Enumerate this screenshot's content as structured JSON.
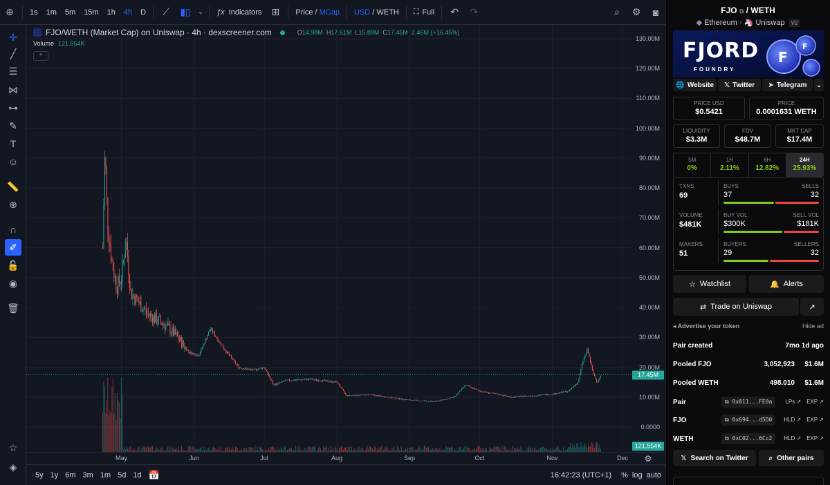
{
  "topbar": {
    "intervals": [
      "1s",
      "1m",
      "5m",
      "15m",
      "1h",
      "4h",
      "D"
    ],
    "active_interval": "4h",
    "indicators_label": "Indicators",
    "price_label": "Price",
    "mcap_label": "MCap",
    "usd_label": "USD",
    "weth_label": "WETH",
    "full_label": "Full"
  },
  "chart": {
    "legend_title": "FJO/WETH (Market Cap) on Uniswap · 4h · dexscreener.com",
    "ohlc": {
      "o_label": "O",
      "o": "14.98M",
      "h_label": "H",
      "h": "17.61M",
      "l_label": "L",
      "l": "15.88M",
      "c_label": "C",
      "c": "17.45M",
      "change": "2.46M (+16.45%)"
    },
    "volume_label": "Volume",
    "volume_value": "121.554K",
    "current_price_badge": "17.45M",
    "current_volume_badge": "121.554K"
  },
  "chart_data": {
    "type": "line",
    "ylabel": "Market Cap",
    "ylim": [
      0,
      130000000
    ],
    "y_ticks": [
      "130.00M",
      "120.00M",
      "110.00M",
      "100.00M",
      "90.00M",
      "80.00M",
      "70.00M",
      "60.00M",
      "50.00M",
      "40.00M",
      "30.00M",
      "20.00M",
      "10.00M",
      "0.0000"
    ],
    "x_ticks": [
      "May",
      "Jun",
      "Jul",
      "Aug",
      "Sep",
      "Oct",
      "Nov",
      "Dec"
    ],
    "series": [
      {
        "x": [
          "Apr 23",
          "Apr 24",
          "Apr 25",
          "Apr 27",
          "Apr 29",
          "May 1",
          "May 3",
          "May 5",
          "May 8",
          "May 12",
          "May 16",
          "May 20",
          "May 25",
          "May 30",
          "Jun 3",
          "Jun 8",
          "Jun 14",
          "Jun 20",
          "Jun 26",
          "Jul 1",
          "Jul 5",
          "Jul 10",
          "Jul 20",
          "Aug 1",
          "Aug 5",
          "Aug 15",
          "Sep 1",
          "Sep 12",
          "Sep 20",
          "Sep 25",
          "Oct 1",
          "Oct 15",
          "Nov 1",
          "Nov 8",
          "Nov 12",
          "Nov 14",
          "Nov 16",
          "Nov 18",
          "Nov 20",
          "Nov 22"
        ],
        "values": [
          60000000,
          93000000,
          70000000,
          55000000,
          47000000,
          50000000,
          63000000,
          45000000,
          42000000,
          38000000,
          36000000,
          34000000,
          30000000,
          25000000,
          24000000,
          33000000,
          26000000,
          20000000,
          19000000,
          20000000,
          14000000,
          15500000,
          16000000,
          15000000,
          10500000,
          10800000,
          9000000,
          8500000,
          10000000,
          14000000,
          12000000,
          10000000,
          11000000,
          12000000,
          15000000,
          22000000,
          26000000,
          19000000,
          15000000,
          17450000
        ]
      }
    ]
  },
  "bottombar": {
    "ranges": [
      "5y",
      "1y",
      "6m",
      "3m",
      "1m",
      "5d",
      "1d"
    ],
    "time": "16:42:23 (UTC+1)",
    "pct_label": "%",
    "log_label": "log",
    "auto_label": "auto"
  },
  "panel": {
    "pair_base": "FJO",
    "pair_quote": "/ WETH",
    "chain": "Ethereum",
    "dex": "Uniswap",
    "dex_version": "V2",
    "banner_logo": "FJORD",
    "banner_sub": "FOUNDRY",
    "links": [
      "Website",
      "Twitter",
      "Telegram"
    ],
    "price_usd_label": "PRICE USD",
    "price_usd": "$0.5421",
    "price_label": "PRICE",
    "price_native": "0.0001631 WETH",
    "liquidity_label": "LIQUIDITY",
    "liquidity": "$3.3M",
    "fdv_label": "FDV",
    "fdv": "$48.7M",
    "mktcap_label": "MKT CAP",
    "mktcap": "$17.4M",
    "timeframes": [
      {
        "label": "5M",
        "value": "0%"
      },
      {
        "label": "1H",
        "value": "2.11%"
      },
      {
        "label": "6H",
        "value": "12.82%"
      },
      {
        "label": "24H",
        "value": "25.93%"
      }
    ],
    "txns_label": "TXNS",
    "txns": "69",
    "buys_label": "BUYS",
    "buys": "37",
    "sells_label": "SELLS",
    "sells": "32",
    "volume_label": "VOLUME",
    "volume": "$481K",
    "buyvol_label": "BUY VOL",
    "buyvol": "$300K",
    "sellvol_label": "SELL VOL",
    "sellvol": "$181K",
    "makers_label": "MAKERS",
    "makers": "51",
    "buyers_label": "BUYERS",
    "buyers": "29",
    "sellers_label": "SELLERS",
    "sellers": "32",
    "watchlist_label": "Watchlist",
    "alerts_label": "Alerts",
    "trade_label": "Trade on Uniswap",
    "advertise_label": "Advertise your token",
    "hide_ad_label": "Hide ad",
    "pair_created_label": "Pair created",
    "pair_created": "7mo 1d ago",
    "pooled_fjo_label": "Pooled FJO",
    "pooled_fjo_amount": "3,052,923",
    "pooled_fjo_usd": "$1.6M",
    "pooled_weth_label": "Pooled WETH",
    "pooled_weth_amount": "498.010",
    "pooled_weth_usd": "$1.6M",
    "pair_label": "Pair",
    "pair_addr": "0x811...FE0a",
    "pair_link1": "LPs",
    "fjo_label": "FJO",
    "fjo_addr": "0x694...d5D0",
    "fjo_link1": "HLD",
    "weth_label": "WETH",
    "weth_addr": "0xC02...6Cc2",
    "weth_link1": "HLD",
    "exp_label": "EXP",
    "search_twitter_label": "Search on Twitter",
    "other_pairs_label": "Other pairs"
  }
}
